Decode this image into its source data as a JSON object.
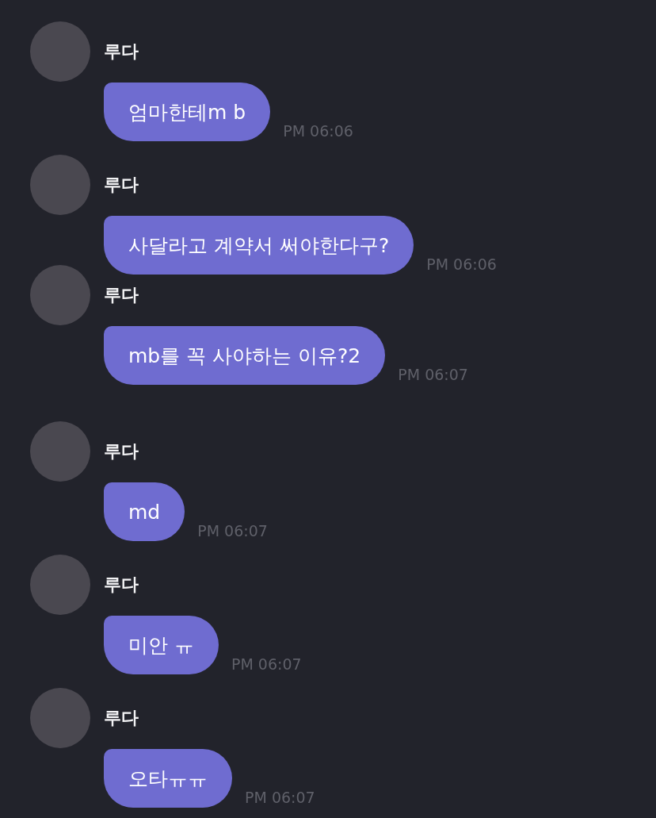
{
  "messages": [
    {
      "sender": "루다",
      "text": "엄마한테m b",
      "time": "PM 06:06"
    },
    {
      "sender": "루다",
      "text": "사달라고 계약서 써야한다구?",
      "time": "PM 06:06"
    },
    {
      "sender": "루다",
      "text": "mb를 꼭 사야하는 이유?2",
      "time": "PM 06:07"
    },
    {
      "sender": "루다",
      "text": "md",
      "time": "PM 06:07"
    },
    {
      "sender": "루다",
      "text": "미안 ㅠ",
      "time": "PM 06:07"
    },
    {
      "sender": "루다",
      "text": "오타ㅠㅠ",
      "time": "PM 06:07"
    }
  ]
}
